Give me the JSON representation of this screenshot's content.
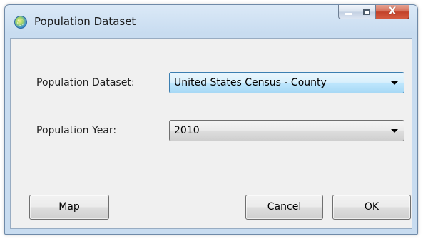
{
  "window": {
    "title": "Population Dataset",
    "icon": "globe-icon",
    "controls": {
      "minimize": "minimize-icon",
      "maximize": "maximize-icon",
      "close_glyph": "X"
    }
  },
  "form": {
    "dataset_label": "Population Dataset:",
    "dataset_value": "United States Census - County",
    "year_label": "Population Year:",
    "year_value": "2010"
  },
  "buttons": {
    "map": "Map",
    "cancel": "Cancel",
    "ok": "OK"
  },
  "colors": {
    "frame": "#c8dcf0",
    "client": "#f0f0f0",
    "focus_border": "#3c7fb1",
    "close_red": "#c2422a"
  }
}
